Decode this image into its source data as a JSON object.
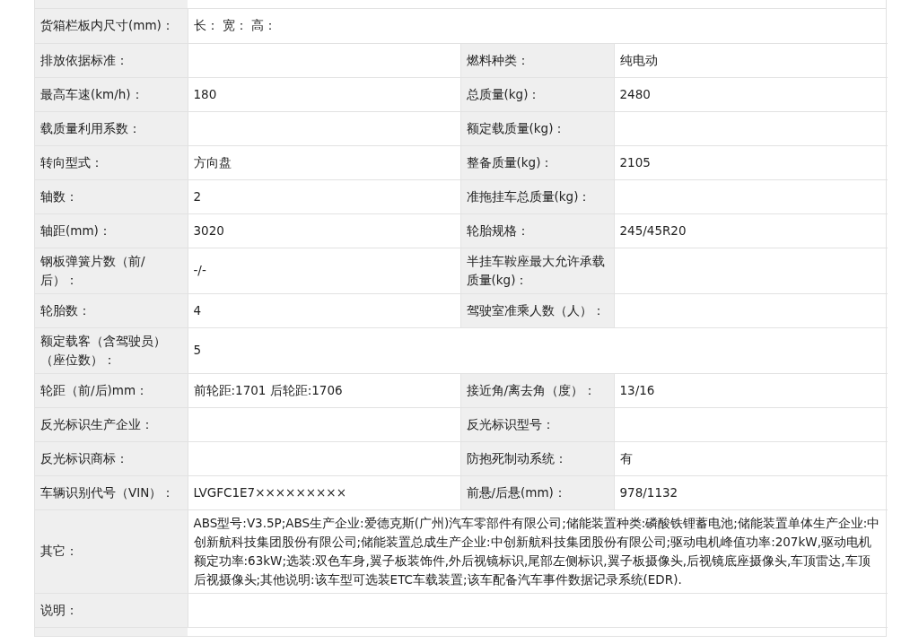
{
  "rows": [
    {
      "kind": "wide",
      "label": "货箱栏板内尺寸(mm)：",
      "value": "长： 宽： 高："
    },
    {
      "kind": "pair",
      "label": "排放依据标准：",
      "value": "",
      "label2": "燃料种类：",
      "value2": "纯电动"
    },
    {
      "kind": "pair",
      "label": "最高车速(km/h)：",
      "value": "180",
      "label2": "总质量(kg)：",
      "value2": "2480"
    },
    {
      "kind": "pair",
      "label": "载质量利用系数：",
      "value": "",
      "label2": "额定载质量(kg)：",
      "value2": ""
    },
    {
      "kind": "pair",
      "label": "转向型式：",
      "value": "方向盘",
      "label2": "整备质量(kg)：",
      "value2": "2105"
    },
    {
      "kind": "pair",
      "label": "轴数：",
      "value": "2",
      "label2": "准拖挂车总质量(kg)：",
      "value2": ""
    },
    {
      "kind": "pair",
      "label": "轴距(mm)：",
      "value": "3020",
      "label2": "轮胎规格：",
      "value2": "245/45R20"
    },
    {
      "kind": "pair",
      "label": "钢板弹簧片数（前/后）：",
      "value": "-/-",
      "label2": "半挂车鞍座最大允许承载质量(kg)：",
      "value2": ""
    },
    {
      "kind": "pair",
      "label": "轮胎数：",
      "value": "4",
      "label2": "驾驶室准乘人数（人）：",
      "value2": ""
    },
    {
      "kind": "wide",
      "label": "额定载客（含驾驶员）（座位数）：",
      "value": "5"
    },
    {
      "kind": "pair",
      "label": "轮距（前/后)mm：",
      "value": "前轮距:1701 后轮距:1706",
      "label2": "接近角/离去角（度）：",
      "value2": "13/16"
    },
    {
      "kind": "pair",
      "label": "反光标识生产企业：",
      "value": "",
      "label2": "反光标识型号：",
      "value2": ""
    },
    {
      "kind": "pair",
      "label": "反光标识商标：",
      "value": "",
      "label2": "防抱死制动系统：",
      "value2": "有"
    },
    {
      "kind": "pair",
      "label": "车辆识别代号（VIN）：",
      "value": "LVGFC1E7×××××××××",
      "label2": "前悬/后悬(mm)：",
      "value2": "978/1132"
    },
    {
      "kind": "wide",
      "label": "其它：",
      "value": "ABS型号:V3.5P;ABS生产企业:爱德克斯(广州)汽车零部件有限公司;储能装置种类:磷酸铁锂蓄电池;储能装置单体生产企业:中创新航科技集团股份有限公司;储能装置总成生产企业:中创新航科技集团股份有限公司;驱动电机峰值功率:207kW,驱动电机额定功率:63kW;选装:双色车身,翼子板装饰件,外后视镜标识,尾部左侧标识,翼子板摄像头,后视镜底座摄像头,车顶雷达,车顶后视摄像头;其他说明:该车型可选装ETC车载装置;该车配备汽车事件数据记录系统(EDR)."
    },
    {
      "kind": "wide",
      "label": "说明：",
      "value": ""
    }
  ]
}
